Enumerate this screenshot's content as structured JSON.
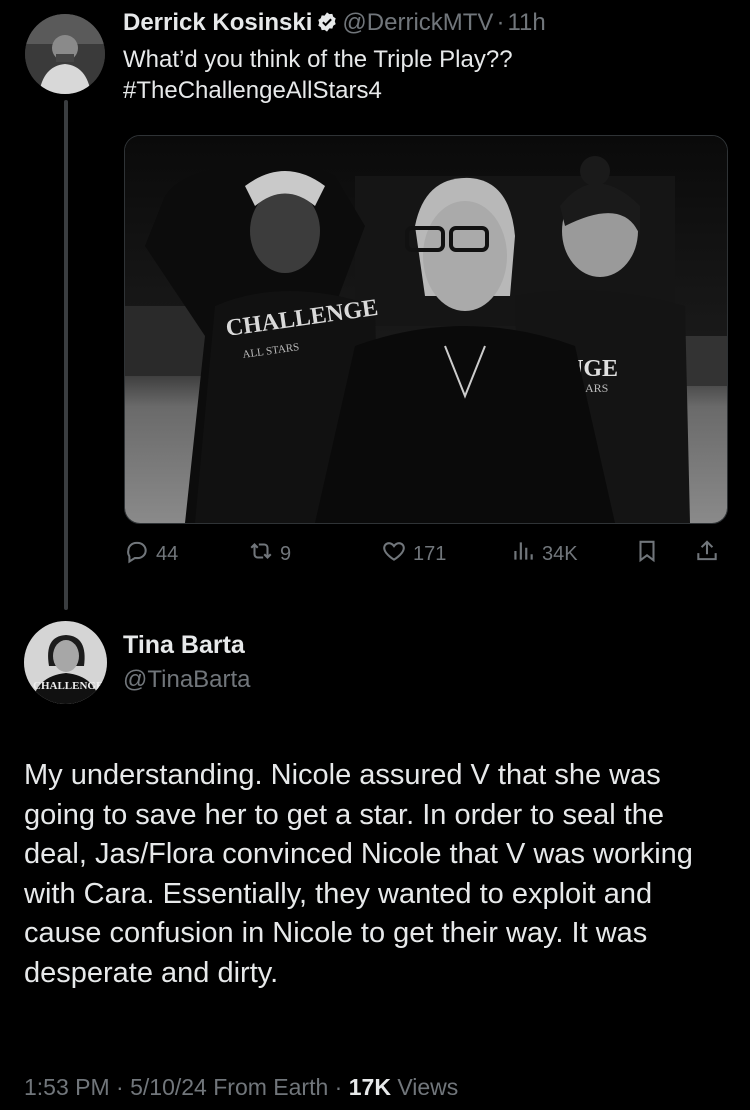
{
  "tweet": {
    "author_name": "Derrick Kosinski",
    "handle": "@DerrickMTV",
    "separator": "·",
    "time": "11h",
    "line1": "What’d you think of the Triple Play??",
    "line2": "#TheChallengeAllStars4",
    "image_shirt_text_1": "CHALLENGE",
    "image_shirt_sub_1": "ALL STARS",
    "image_shirt_text_2": "ENGE",
    "image_shirt_sub_2": "ARS",
    "actions": {
      "replies": "44",
      "reposts": "9",
      "likes": "171",
      "views": "34K"
    }
  },
  "reply": {
    "author_name": "Tina Barta",
    "handle": "@TinaBarta",
    "avatar_shirt_text": "CHALLENGE",
    "text": "My understanding. Nicole assured V that she was going to save her to get a star. In order to seal the deal, Jas/Flora convinced Nicole that V was working with Cara.  Essentially, they wanted to exploit and cause confusion in Nicole to get their way.  It was desperate and dirty.",
    "time": "1:53 PM",
    "date": "5/10/24",
    "from": "From Earth",
    "views_count": "17K",
    "views_label": "Views",
    "separator": "·"
  },
  "icons": [
    "verified-badge-icon",
    "reply-icon",
    "repost-icon",
    "like-icon",
    "views-icon",
    "bookmark-icon",
    "share-icon"
  ]
}
